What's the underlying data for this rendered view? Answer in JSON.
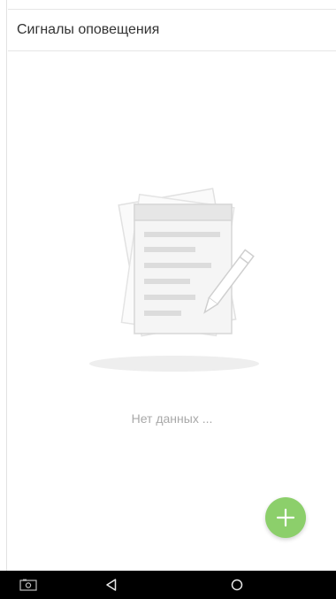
{
  "header": {
    "title": "Сигналы оповещения"
  },
  "empty_state": {
    "text": "Нет данных ..."
  },
  "fab": {
    "icon": "plus-icon",
    "color": "#8ccf6b"
  },
  "navbar": {
    "buttons": [
      "screenshot-icon",
      "back-icon",
      "home-icon"
    ]
  }
}
